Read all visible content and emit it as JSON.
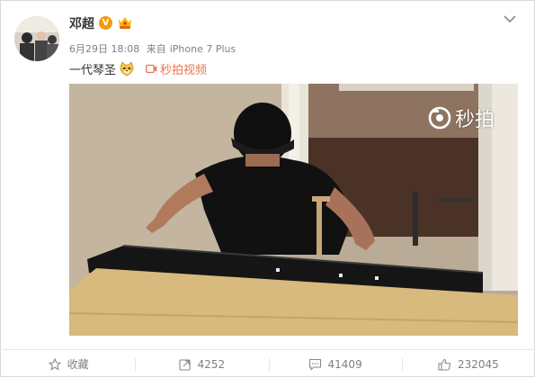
{
  "post": {
    "username": "邓超",
    "verified_badge": "V",
    "timestamp": "6月29日 18:08",
    "source_prefix": "来自",
    "source_device": "iPhone 7 Plus",
    "text": "一代琴圣",
    "video_link_label": "秒拍视频",
    "video_watermark": "秒拍"
  },
  "actions": {
    "favorite_label": "收藏",
    "repost_count": "4252",
    "comment_count": "41409",
    "like_count": "232045"
  },
  "colors": {
    "link": "#eb7350",
    "badge": "#f29b0a",
    "muted_text": "#808080"
  }
}
